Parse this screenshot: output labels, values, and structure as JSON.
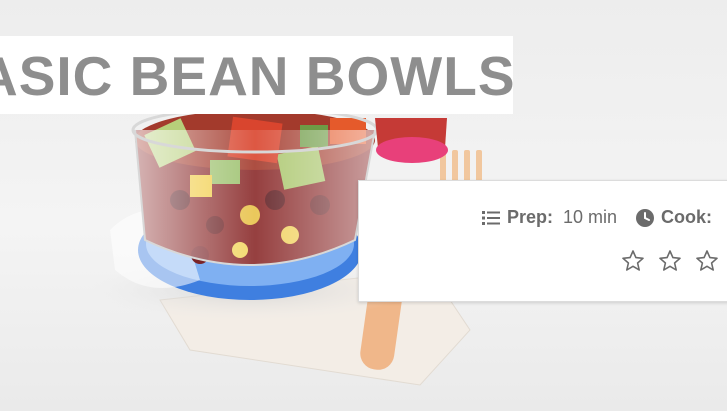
{
  "recipe": {
    "title": "ASIC BEAN BOWLS",
    "prep_label": "Prep:",
    "prep_value": "10 min",
    "cook_label": "Cook:"
  },
  "rating": {
    "stars_total_visible": 3,
    "filled": 0
  },
  "icons": {
    "prep": "list-icon",
    "cook": "clock-icon",
    "rating": "star-outline-icon"
  },
  "colors": {
    "title_text": "#8e8e8e",
    "meta_text": "#6b6b6b",
    "band_bg": "#ffffff"
  }
}
